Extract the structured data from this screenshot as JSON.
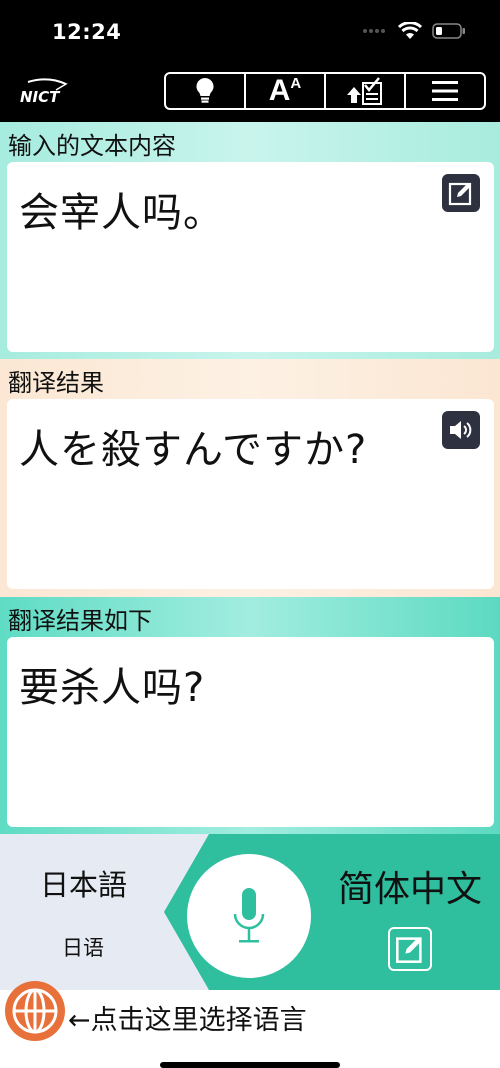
{
  "status": {
    "time": "12:24"
  },
  "app": {
    "logo_text": "NICT"
  },
  "toolbar": {
    "font_label_big": "A",
    "font_label_small": "A"
  },
  "input": {
    "label": "输入的文本内容",
    "text": "会宰人吗。"
  },
  "result": {
    "label": "翻译结果",
    "text": "人を殺すんですか?"
  },
  "back_translation": {
    "label": "翻译结果如下",
    "text": "要杀人吗?"
  },
  "languages": {
    "source_name": "日本語",
    "source_subtitle": "日语",
    "target_name": "简体中文"
  },
  "language_select": {
    "hint": "←点击这里选择语言"
  },
  "colors": {
    "accent": "#2fbf9f",
    "input_bg": "#a6ecdf",
    "result_bg": "#fbe7d3",
    "back_bg": "#5fdcc4",
    "icon_btn": "#2d3140",
    "globe": "#e8703a"
  }
}
